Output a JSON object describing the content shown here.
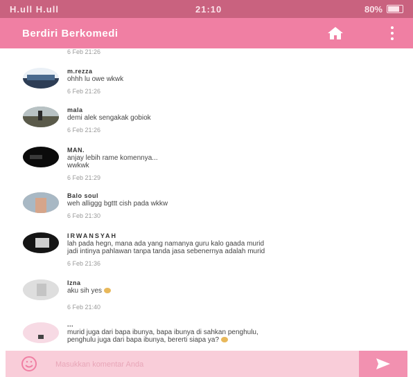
{
  "status_bar": {
    "signal_text": "H.ull H.ull",
    "time": "21:10",
    "battery": "80%",
    "battery_level": 0.8
  },
  "app_bar": {
    "title": "Berdiri Berkomedi",
    "home_icon": "home-icon",
    "menu_icon": "more-vert-icon"
  },
  "first_time": "6 Feb 21:26",
  "comments": [
    {
      "name": "m.rezza",
      "text": "ohhh lu owe wkwk",
      "time": "6 Feb 21:26"
    },
    {
      "name": "mala",
      "text": "demi alek sengakak gobiok",
      "time": "6 Feb 21:26"
    },
    {
      "name": "MAN.",
      "text": "anjay lebih rame komennya...",
      "text2": "wwkwk",
      "time": "6 Feb 21:29"
    },
    {
      "name": "Balo soul",
      "text": "weh alliggg bgttt cish pada wkkw",
      "time": "6 Feb 21:30"
    },
    {
      "name": "IRWANSYAH",
      "text": "lah pada hegn, mana ada yang namanya guru kalo gaada murid",
      "text2": "jadi intinya pahlawan tanpa tanda jasa sebenernya adalah murid",
      "time": "6 Feb 21:36"
    },
    {
      "name": "Izna",
      "text": "aku sih yes",
      "time": "6 Feb 21:40"
    },
    {
      "name": "...",
      "text": "murid juga dari bapa ibunya, bapa ibunya di sahkan penghulu,",
      "text2": "penghulu juga dari bapa ibunya, bererti siapa ya?"
    }
  ],
  "input_bar": {
    "placeholder": "Masukkan komentar Anda",
    "emoji_icon": "smiley-icon",
    "send_icon": "send-icon"
  },
  "colors": {
    "status_bar": "#c9627f",
    "app_bar": "#f07fa3",
    "input_bar": "#f9cdd9",
    "send_button": "#f291b0"
  }
}
